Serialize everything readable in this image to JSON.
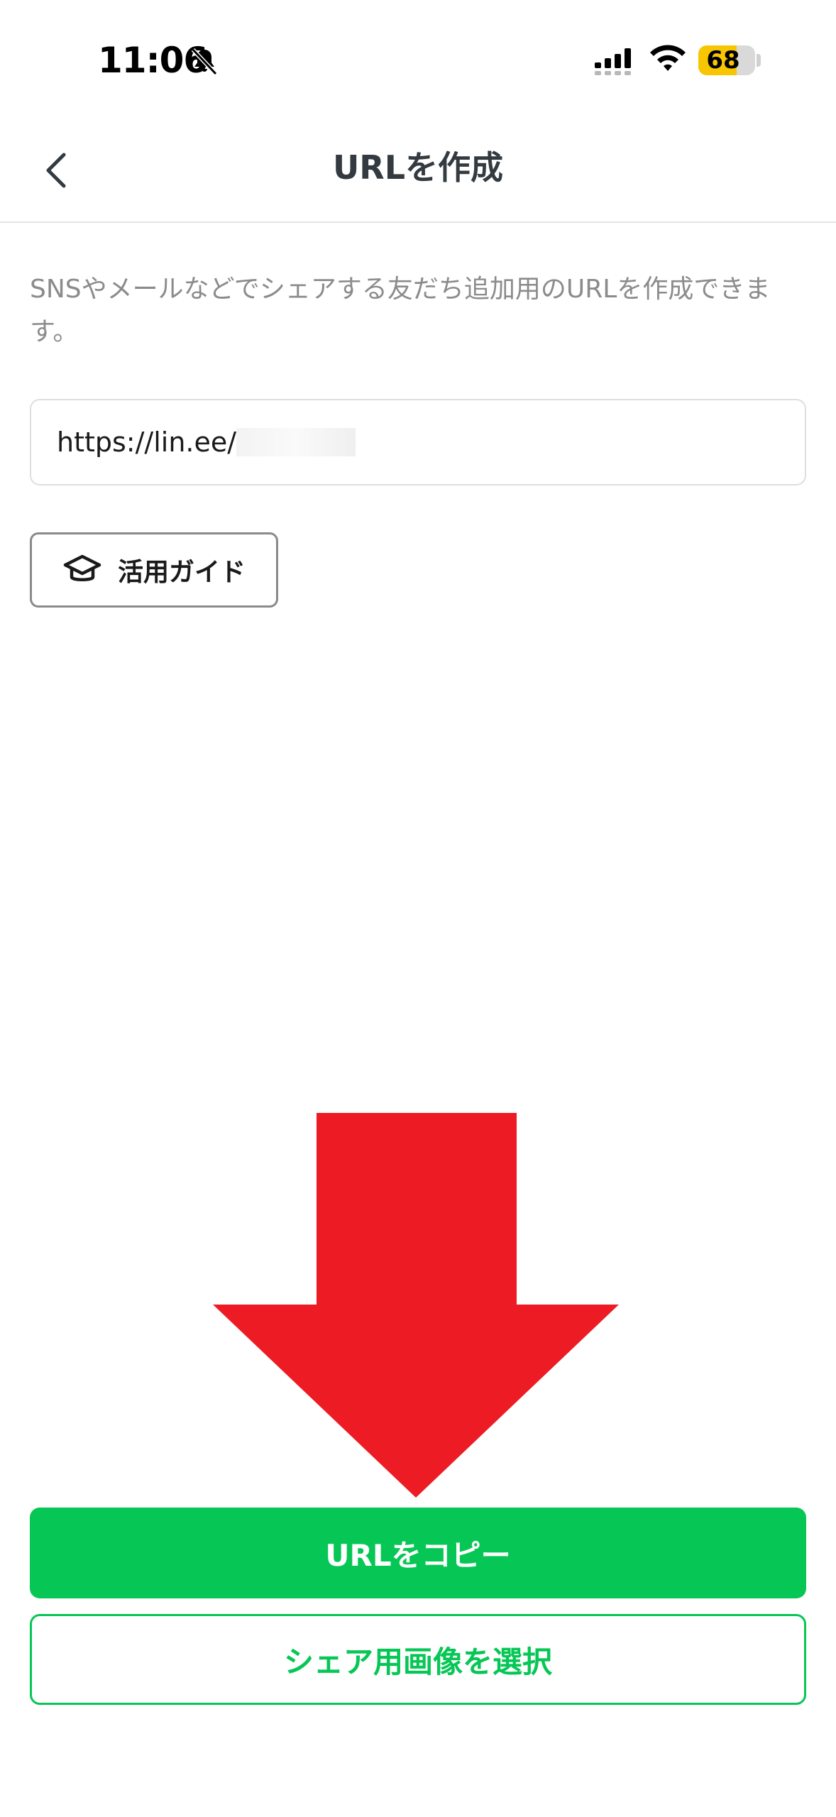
{
  "status_bar": {
    "time": "11:06",
    "battery": "68",
    "battery_level": 0.68,
    "icons": [
      "bell-slash-icon",
      "cellular-signal-icon",
      "wifi-icon",
      "battery-icon"
    ]
  },
  "nav": {
    "title": "URLを作成",
    "back_icon": "chevron-left-icon"
  },
  "description": "SNSやメールなどでシェアする友だち追加用のURLを作成できます。",
  "url_field": {
    "value_visible": "https://lin.ee/"
  },
  "guide_button": {
    "label": "活用ガイド",
    "icon": "graduation-cap-icon"
  },
  "annotation_arrow": {
    "color": "#ed1c24"
  },
  "actions": {
    "copy_url_label": "URLをコピー",
    "select_image_label": "シェア用画像を選択"
  },
  "colors": {
    "brand_green": "#06c755",
    "battery_yellow": "#f7c600"
  }
}
